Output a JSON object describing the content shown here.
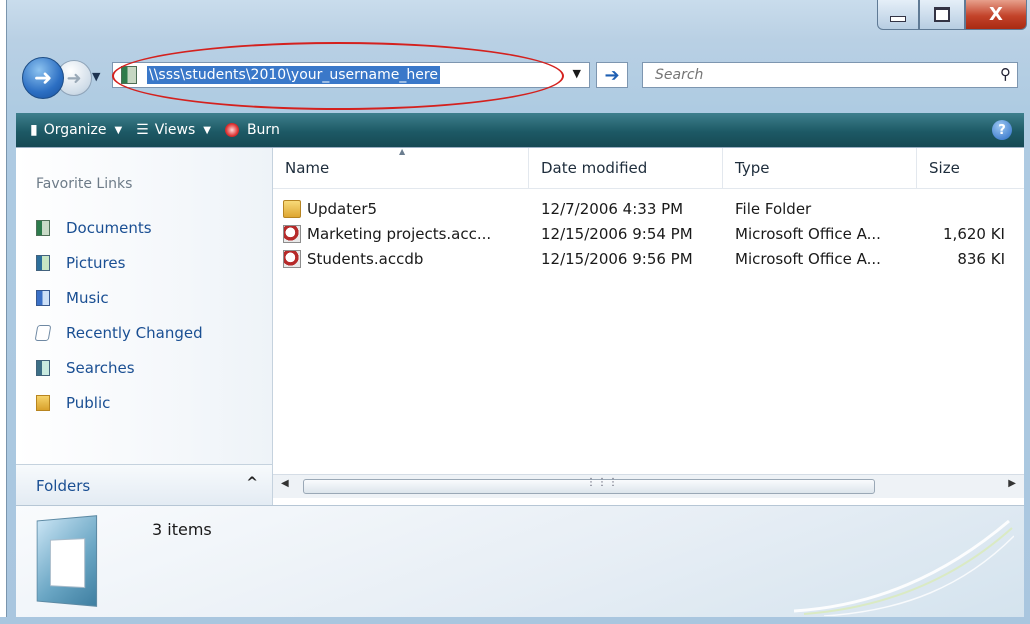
{
  "window": {
    "caption_close": "X"
  },
  "nav": {
    "address_path": "\\\\sss\\students\\2010\\your_username_here",
    "search_placeholder": "Search"
  },
  "toolbar": {
    "organize_label": "Organize",
    "views_label": "Views",
    "burn_label": "Burn",
    "help_label": "?"
  },
  "sidebar": {
    "favorite_title": "Favorite Links",
    "items": [
      {
        "label": "Documents",
        "icon": "documents-icon"
      },
      {
        "label": "Pictures",
        "icon": "pictures-icon"
      },
      {
        "label": "Music",
        "icon": "music-icon"
      },
      {
        "label": "Recently Changed",
        "icon": "recently-changed-icon"
      },
      {
        "label": "Searches",
        "icon": "searches-icon"
      },
      {
        "label": "Public",
        "icon": "public-folder-icon"
      }
    ],
    "folders_label": "Folders"
  },
  "filelist": {
    "columns": [
      "Name",
      "Date modified",
      "Type",
      "Size"
    ],
    "rows": [
      {
        "name": "Updater5",
        "date": "12/7/2006 4:33 PM",
        "type": "File Folder",
        "size": "",
        "icon": "folder-icon"
      },
      {
        "name": "Marketing projects.acc...",
        "date": "12/15/2006 9:54 PM",
        "type": "Microsoft Office A...",
        "size": "1,620 KI",
        "icon": "access-database-icon"
      },
      {
        "name": "Students.accdb",
        "date": "12/15/2006 9:56 PM",
        "type": "Microsoft Office A...",
        "size": "836 KI",
        "icon": "access-database-icon"
      }
    ]
  },
  "details": {
    "item_count": "3 items"
  },
  "colors": {
    "toolbar": "#1d5965",
    "link": "#1a4f93",
    "selection": "#3a78c9",
    "annotation": "#d4211e"
  }
}
